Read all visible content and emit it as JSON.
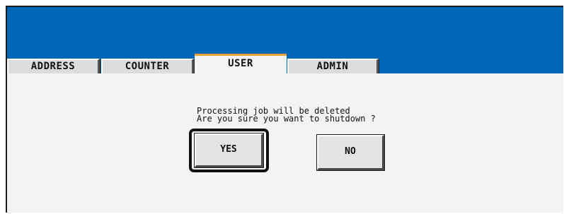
{
  "tabs": [
    {
      "label": "ADDRESS",
      "active": false
    },
    {
      "label": "COUNTER",
      "active": false
    },
    {
      "label": "USER",
      "active": true
    },
    {
      "label": "ADMIN",
      "active": false
    }
  ],
  "dialog": {
    "message_line1": "Processing job will be deleted",
    "message_line2": "Are you sure you want to shutdown ?",
    "yes_label": "YES",
    "no_label": "NO",
    "focused_button": "YES"
  },
  "colors": {
    "header_band": "#0067b6",
    "active_tab_accent": "#e8a23c",
    "panel_background": "#f3f3f3"
  }
}
